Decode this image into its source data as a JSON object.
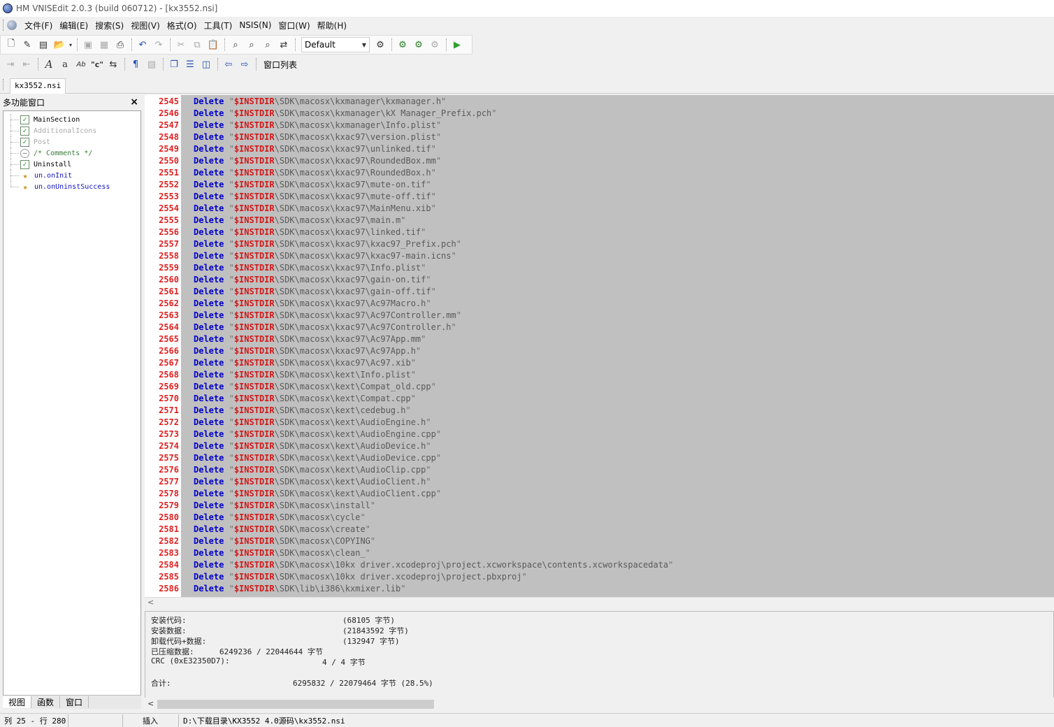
{
  "window": {
    "title": "HM VNISEdit 2.0.3 (build 060712) - [kx3552.nsi]"
  },
  "menu": [
    "文件(F)",
    "编辑(E)",
    "搜索(S)",
    "视图(V)",
    "格式(O)",
    "工具(T)",
    "NSIS(N)",
    "窗口(W)",
    "帮助(H)"
  ],
  "toolbar": {
    "scheme_value": "Default",
    "window_list_label": "窗口列表"
  },
  "tabs": {
    "document": "kx3552.nsi"
  },
  "left_panel": {
    "title": "多功能窗口",
    "tree": [
      {
        "label": "MainSection",
        "icon": "checkbox-checked",
        "color": "black"
      },
      {
        "label": "AdditionalIcons",
        "icon": "checkbox-checked",
        "color": "gray"
      },
      {
        "label": "Post",
        "icon": "checkbox-checked",
        "color": "gray"
      },
      {
        "label": "/* Comments */",
        "icon": "comment-circle",
        "color": "green"
      },
      {
        "label": "Uninstall",
        "icon": "checkbox-checked",
        "color": "black"
      },
      {
        "label": "un.onInit",
        "icon": "function-star",
        "color": "blue"
      },
      {
        "label": "un.onUninstSuccess",
        "icon": "function-star",
        "color": "blue"
      }
    ],
    "bottom_tabs": [
      "视图",
      "函数",
      "窗口"
    ]
  },
  "editor": {
    "keyword": "Delete",
    "variable": "$INSTDIR",
    "lines": [
      {
        "n": "2545",
        "path": "\\SDK\\macosx\\kxmanager\\kxmanager.h"
      },
      {
        "n": "2546",
        "path": "\\SDK\\macosx\\kxmanager\\kX Manager_Prefix.pch"
      },
      {
        "n": "2547",
        "path": "\\SDK\\macosx\\kxmanager\\Info.plist"
      },
      {
        "n": "2548",
        "path": "\\SDK\\macosx\\kxac97\\version.plist"
      },
      {
        "n": "2549",
        "path": "\\SDK\\macosx\\kxac97\\unlinked.tif"
      },
      {
        "n": "2550",
        "path": "\\SDK\\macosx\\kxac97\\RoundedBox.mm"
      },
      {
        "n": "2551",
        "path": "\\SDK\\macosx\\kxac97\\RoundedBox.h"
      },
      {
        "n": "2552",
        "path": "\\SDK\\macosx\\kxac97\\mute-on.tif"
      },
      {
        "n": "2553",
        "path": "\\SDK\\macosx\\kxac97\\mute-off.tif"
      },
      {
        "n": "2554",
        "path": "\\SDK\\macosx\\kxac97\\MainMenu.xib"
      },
      {
        "n": "2555",
        "path": "\\SDK\\macosx\\kxac97\\main.m"
      },
      {
        "n": "2556",
        "path": "\\SDK\\macosx\\kxac97\\linked.tif"
      },
      {
        "n": "2557",
        "path": "\\SDK\\macosx\\kxac97\\kxac97_Prefix.pch"
      },
      {
        "n": "2558",
        "path": "\\SDK\\macosx\\kxac97\\kxac97-main.icns"
      },
      {
        "n": "2559",
        "path": "\\SDK\\macosx\\kxac97\\Info.plist"
      },
      {
        "n": "2560",
        "path": "\\SDK\\macosx\\kxac97\\gain-on.tif"
      },
      {
        "n": "2561",
        "path": "\\SDK\\macosx\\kxac97\\gain-off.tif"
      },
      {
        "n": "2562",
        "path": "\\SDK\\macosx\\kxac97\\Ac97Macro.h"
      },
      {
        "n": "2563",
        "path": "\\SDK\\macosx\\kxac97\\Ac97Controller.mm"
      },
      {
        "n": "2564",
        "path": "\\SDK\\macosx\\kxac97\\Ac97Controller.h"
      },
      {
        "n": "2565",
        "path": "\\SDK\\macosx\\kxac97\\Ac97App.mm"
      },
      {
        "n": "2566",
        "path": "\\SDK\\macosx\\kxac97\\Ac97App.h"
      },
      {
        "n": "2567",
        "path": "\\SDK\\macosx\\kxac97\\Ac97.xib"
      },
      {
        "n": "2568",
        "path": "\\SDK\\macosx\\kext\\Info.plist"
      },
      {
        "n": "2569",
        "path": "\\SDK\\macosx\\kext\\Compat_old.cpp"
      },
      {
        "n": "2570",
        "path": "\\SDK\\macosx\\kext\\Compat.cpp"
      },
      {
        "n": "2571",
        "path": "\\SDK\\macosx\\kext\\cedebug.h"
      },
      {
        "n": "2572",
        "path": "\\SDK\\macosx\\kext\\AudioEngine.h"
      },
      {
        "n": "2573",
        "path": "\\SDK\\macosx\\kext\\AudioEngine.cpp"
      },
      {
        "n": "2574",
        "path": "\\SDK\\macosx\\kext\\AudioDevice.h"
      },
      {
        "n": "2575",
        "path": "\\SDK\\macosx\\kext\\AudioDevice.cpp"
      },
      {
        "n": "2576",
        "path": "\\SDK\\macosx\\kext\\AudioClip.cpp"
      },
      {
        "n": "2577",
        "path": "\\SDK\\macosx\\kext\\AudioClient.h"
      },
      {
        "n": "2578",
        "path": "\\SDK\\macosx\\kext\\AudioClient.cpp"
      },
      {
        "n": "2579",
        "path": "\\SDK\\macosx\\install"
      },
      {
        "n": "2580",
        "path": "\\SDK\\macosx\\cycle"
      },
      {
        "n": "2581",
        "path": "\\SDK\\macosx\\create"
      },
      {
        "n": "2582",
        "path": "\\SDK\\macosx\\COPYING"
      },
      {
        "n": "2583",
        "path": "\\SDK\\macosx\\clean_"
      },
      {
        "n": "2584",
        "path": "\\SDK\\macosx\\10kx driver.xcodeproj\\project.xcworkspace\\contents.xcworkspacedata"
      },
      {
        "n": "2585",
        "path": "\\SDK\\macosx\\10kx driver.xcodeproj\\project.pbxproj"
      },
      {
        "n": "2586",
        "path": "\\SDK\\lib\\i386\\kxmixer.lib"
      }
    ]
  },
  "output": {
    "rows": [
      {
        "label": "安装代码:",
        "value": "(68105 字节)",
        "col": "far"
      },
      {
        "label": "安装数据:",
        "value": "(21843592 字节)",
        "col": "far"
      },
      {
        "label": "卸载代码+数据:",
        "value": "(132947 字节)",
        "col": "far"
      },
      {
        "label": "已压缩数据:",
        "value": "6249236 / 22044644 字节",
        "col": "near"
      },
      {
        "label": "CRC (0xE32350D7):",
        "value": "4 / 4 字节",
        "col": "mid"
      },
      {
        "label": "",
        "value": "",
        "col": "near"
      },
      {
        "label": "合计:",
        "value": "6295832 / 22079464 字节 (28.5%)",
        "col": "total"
      }
    ]
  },
  "status": {
    "position": "列 25 - 行 280",
    "mode": "插入",
    "path": "D:\\下载目录\\KX3552 4.0源码\\kx3552.nsi"
  }
}
